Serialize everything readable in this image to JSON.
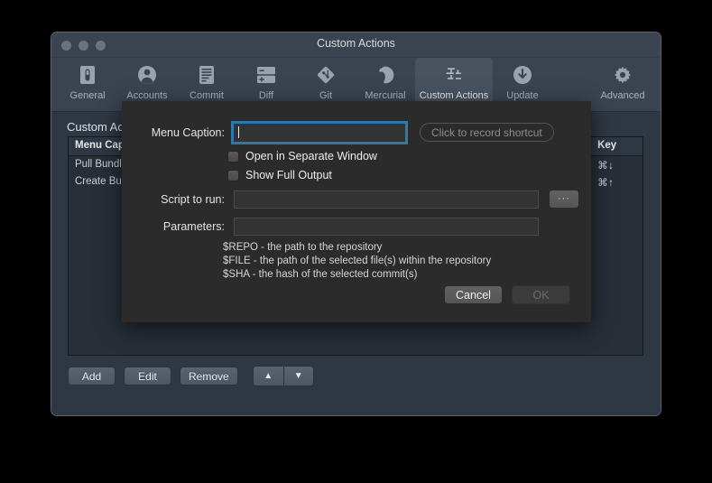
{
  "window": {
    "title": "Custom Actions",
    "traffic_lights": [
      "close-button",
      "minimize-button",
      "zoom-button"
    ]
  },
  "toolbar": {
    "items": [
      {
        "label": "General",
        "icon": "general-icon",
        "selected": false
      },
      {
        "label": "Accounts",
        "icon": "accounts-icon",
        "selected": false
      },
      {
        "label": "Commit",
        "icon": "commit-icon",
        "selected": false
      },
      {
        "label": "Diff",
        "icon": "diff-icon",
        "selected": false
      },
      {
        "label": "Git",
        "icon": "git-icon",
        "selected": false
      },
      {
        "label": "Mercurial",
        "icon": "mercurial-icon",
        "selected": false
      },
      {
        "label": "Custom Actions",
        "icon": "custom-actions-icon",
        "selected": true
      },
      {
        "label": "Update",
        "icon": "update-icon",
        "selected": false
      }
    ],
    "right_item": {
      "label": "Advanced",
      "icon": "gear-icon"
    }
  },
  "main": {
    "section_title": "Custom Actions",
    "table": {
      "columns": [
        "Menu Caption",
        "Key"
      ],
      "rows": [
        {
          "caption": "Pull Bundle",
          "key": "⌘↓"
        },
        {
          "caption": "Create Bundle",
          "key": "⌘↑"
        }
      ]
    },
    "buttons": {
      "add": "Add",
      "edit": "Edit",
      "remove": "Remove",
      "move_up": "▲",
      "move_down": "▼"
    }
  },
  "dialog": {
    "menu_caption_label": "Menu Caption:",
    "menu_caption_value": "",
    "shortcut_button": "Click to record shortcut",
    "checkboxes": [
      {
        "label": "Open in Separate Window",
        "checked": false
      },
      {
        "label": "Show Full Output",
        "checked": false
      }
    ],
    "script_label": "Script to run:",
    "script_value": "",
    "browse_button": "···",
    "parameters_label": "Parameters:",
    "parameters_value": "",
    "help_lines": [
      "$REPO - the path to the repository",
      "$FILE - the path of the selected file(s) within the repository",
      "$SHA - the hash of the selected commit(s)"
    ],
    "cancel_button": "Cancel",
    "ok_button": "OK"
  },
  "colors": {
    "window_chrome": "#3a434f",
    "window_body": "#2f3742",
    "sheet_bg": "#2b2b2b",
    "focus_ring": "#2a7ab0",
    "list_bg": "#272e38"
  }
}
